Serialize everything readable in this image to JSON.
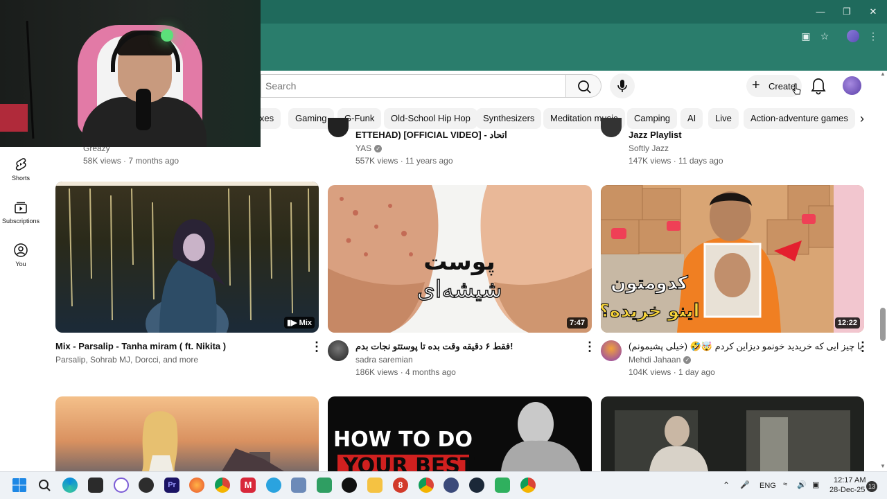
{
  "search": {
    "placeholder": "Search"
  },
  "header": {
    "create_label": "Create"
  },
  "chips": [
    "ixes",
    "Gaming",
    "G-Funk",
    "Old-School Hip Hop",
    "Synthesizers",
    "Meditation music",
    "Camping",
    "AI",
    "Live",
    "Action-adventure games"
  ],
  "sidebar": {
    "items": [
      {
        "label": "Shorts",
        "icon": "shorts-icon"
      },
      {
        "label": "Subscriptions",
        "icon": "subscriptions-icon"
      },
      {
        "label": "You",
        "icon": "you-icon"
      }
    ]
  },
  "top_row": [
    {
      "channel": "Greazy",
      "meta": "58K views · 7 months ago"
    },
    {
      "title": "ETTEHAD) [OFFICIAL VIDEO] - اتحاد",
      "channel": "YAS",
      "meta": "557K views · 11 years ago"
    },
    {
      "title": "Jazz Playlist",
      "channel": "Softly Jazz",
      "meta": "147K views · 11 days ago"
    }
  ],
  "videos": [
    {
      "title": "Mix - Parsalip - Tanha miram  ( ft. Nikita )",
      "channel": "Parsalip, Sohrab MJ, Dorcci, and more",
      "badge": "Mix",
      "meta": ""
    },
    {
      "title": "فقط ۶ دقیقه وقت بده تا پوستتو نجات بدم!",
      "channel": "sadra saremian",
      "duration": "7:47",
      "meta": "186K views · 4 months ago",
      "thumb_text_1": "پوست",
      "thumb_text_2": "شیشه‌ای"
    },
    {
      "title": "با چیز ایی که خریدید خونمو دیزاین کردم 🤯🤣 (خیلی پشیمونم)",
      "channel": "Mehdi Jahaan",
      "duration": "12:22",
      "meta": "104K views · 1 day ago",
      "thumb_text_1": "کدومتون",
      "thumb_text_2": "اینو خریده؟"
    }
  ],
  "bottom_row": [
    {
      "thumb_text_1": "HOW TO DO",
      "thumb_text_2": "YOUR BEST"
    }
  ],
  "tray": {
    "lang": "ENG",
    "time": "12:17 AM",
    "date": "28-Dec-25",
    "notifications": "13"
  },
  "colors": {
    "chrome": "#1f6a5c",
    "chrome_light": "#2a7d6c",
    "accent_red": "#e0245e"
  }
}
